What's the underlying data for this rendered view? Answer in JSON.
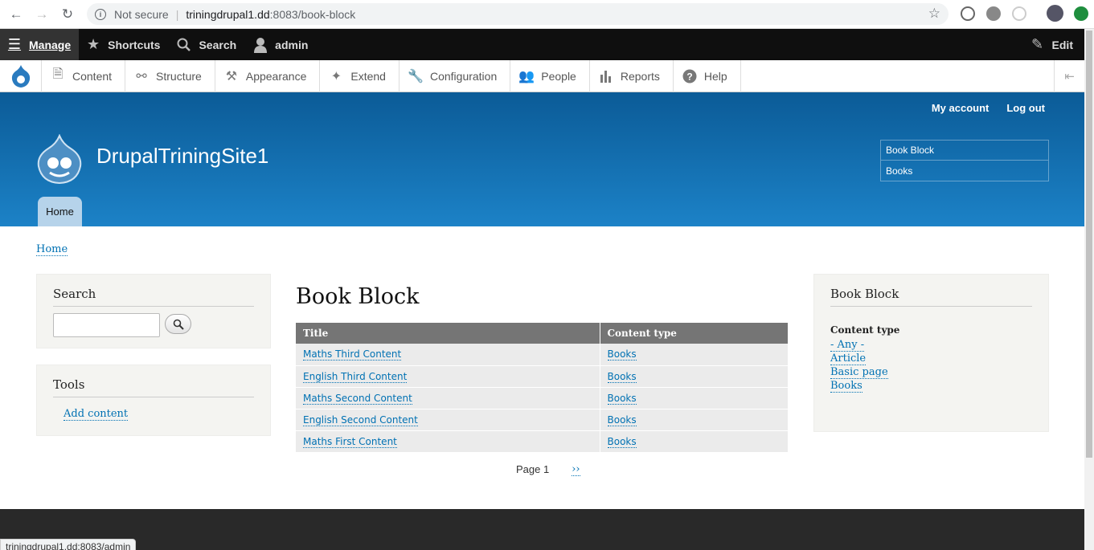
{
  "browser": {
    "security": "Not secure",
    "url_host": "triningdrupal1.dd",
    "url_rest": ":8083/book-block"
  },
  "toolbar": {
    "manage": "Manage",
    "shortcuts": "Shortcuts",
    "search": "Search",
    "user": "admin",
    "edit": "Edit"
  },
  "tray": {
    "items": [
      {
        "label": "Content",
        "icon": "file-icon"
      },
      {
        "label": "Structure",
        "icon": "sitemap-icon"
      },
      {
        "label": "Appearance",
        "icon": "paintbrush-icon"
      },
      {
        "label": "Extend",
        "icon": "puzzle-icon"
      },
      {
        "label": "Configuration",
        "icon": "wrench-icon"
      },
      {
        "label": "People",
        "icon": "people-icon"
      },
      {
        "label": "Reports",
        "icon": "bar-chart-icon"
      },
      {
        "label": "Help",
        "icon": "question-icon"
      }
    ]
  },
  "header": {
    "my_account": "My account",
    "log_out": "Log out",
    "site_name": "DrupalTriningSite1",
    "menu_block": [
      "Book Block",
      "Books"
    ],
    "home_tab": "Home"
  },
  "breadcrumb": "Home",
  "search_block": {
    "title": "Search"
  },
  "tools_block": {
    "title": "Tools",
    "link": "Add content"
  },
  "main": {
    "title": "Book Block",
    "columns": [
      "Title",
      "Content type"
    ],
    "rows": [
      [
        "Maths Third Content",
        "Books"
      ],
      [
        "English Third Content",
        "Books"
      ],
      [
        "Maths Second Content",
        "Books"
      ],
      [
        "English Second Content",
        "Books"
      ],
      [
        "Maths First Content",
        "Books"
      ]
    ],
    "pager_current": "Page 1",
    "pager_next": "››"
  },
  "facet_block": {
    "title": "Book Block",
    "label": "Content type",
    "options": [
      "- Any -",
      "Article",
      "Basic page",
      "Books"
    ]
  },
  "status_bar": "triningdrupal1.dd:8083/admin",
  "colors": {
    "header_top": "#0b5b97",
    "header_bottom": "#1c82c7",
    "link": "#0071b3",
    "toolbar": "#0f0f0f"
  }
}
